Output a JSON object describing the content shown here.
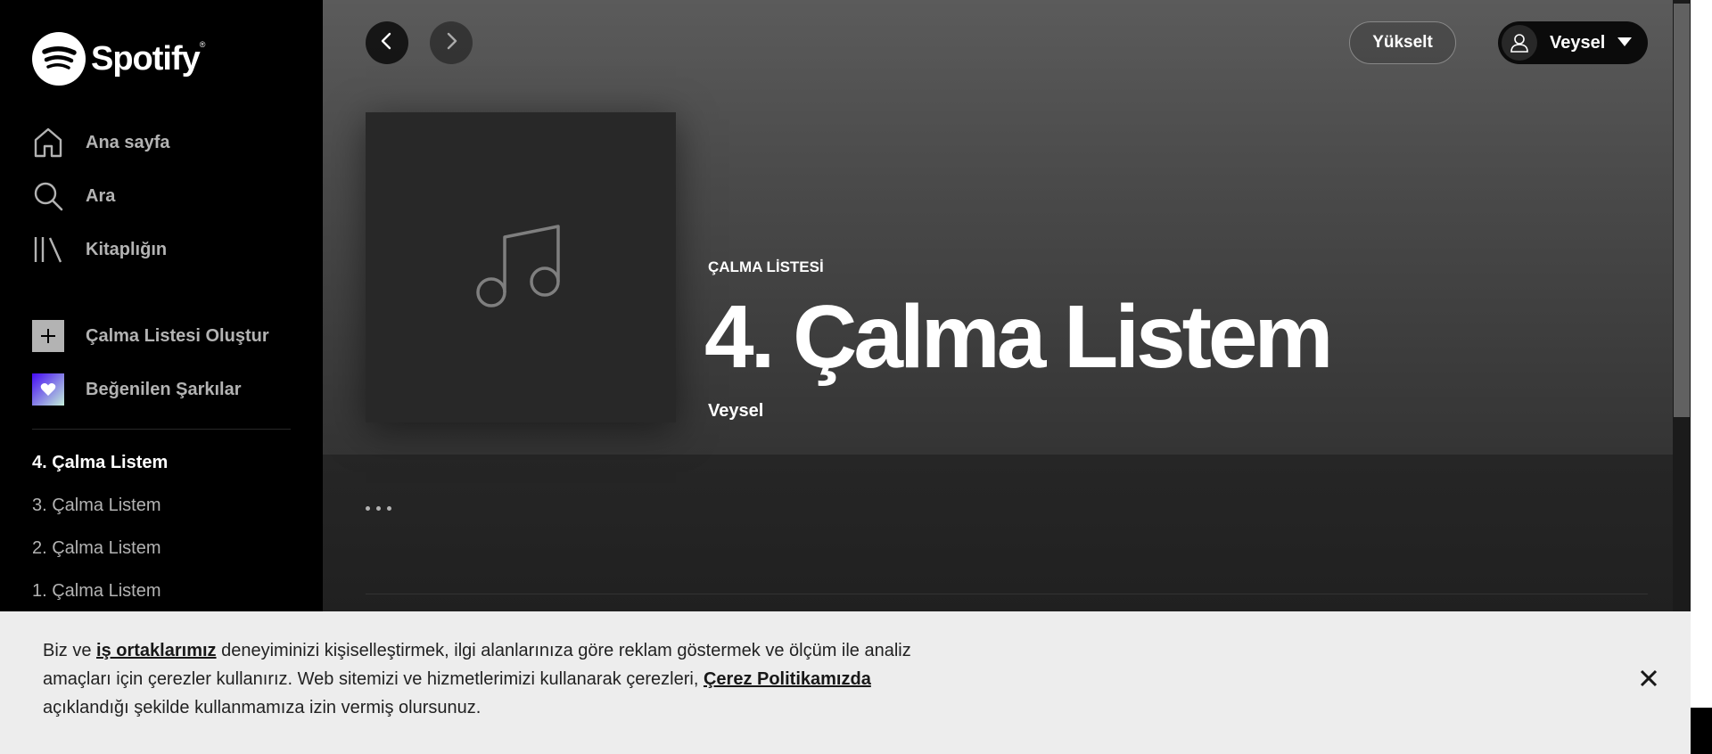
{
  "brand": {
    "name": "Spotify",
    "trademark": "®"
  },
  "sidebar": {
    "nav": [
      {
        "label": "Ana sayfa",
        "icon": "home-icon"
      },
      {
        "label": "Ara",
        "icon": "search-icon"
      },
      {
        "label": "Kitaplığın",
        "icon": "library-icon"
      }
    ],
    "actions": [
      {
        "label": "Çalma Listesi Oluştur",
        "icon": "plus-icon"
      },
      {
        "label": "Beğenilen Şarkılar",
        "icon": "heart-icon"
      }
    ],
    "playlists": [
      {
        "label": "4. Çalma Listem",
        "active": true
      },
      {
        "label": "3. Çalma Listem",
        "active": false
      },
      {
        "label": "2. Çalma Listem",
        "active": false
      },
      {
        "label": "1. Çalma Listem",
        "active": false
      }
    ]
  },
  "topbar": {
    "upgrade_label": "Yükselt",
    "user_name": "Veysel"
  },
  "playlist": {
    "type_label": "ÇALMA LİSTESİ",
    "title": "4. Çalma Listem",
    "owner": "Veysel",
    "cover_icon": "music-note-icon"
  },
  "cookie_banner": {
    "text_1": "Biz ve ",
    "link_1": "iş ortaklarımız",
    "text_2": " deneyiminizi kişiselleştirmek, ilgi alanlarınıza göre reklam göstermek ve ölçüm ile analiz amaçları için çerezler kullanırız. Web sitemizi ve hizmetlerimizi kullanarak çerezleri, ",
    "link_2": "Çerez Politikamızda",
    "text_3": " açıklandığı şekilde kullanmamıza izin vermiş olursunuz.",
    "close_icon": "close-icon"
  },
  "colors": {
    "accent_heart_from": "#450af5",
    "accent_heart_to": "#c4efd9",
    "sidebar_bg": "#000000",
    "banner_bg": "#ededed"
  }
}
